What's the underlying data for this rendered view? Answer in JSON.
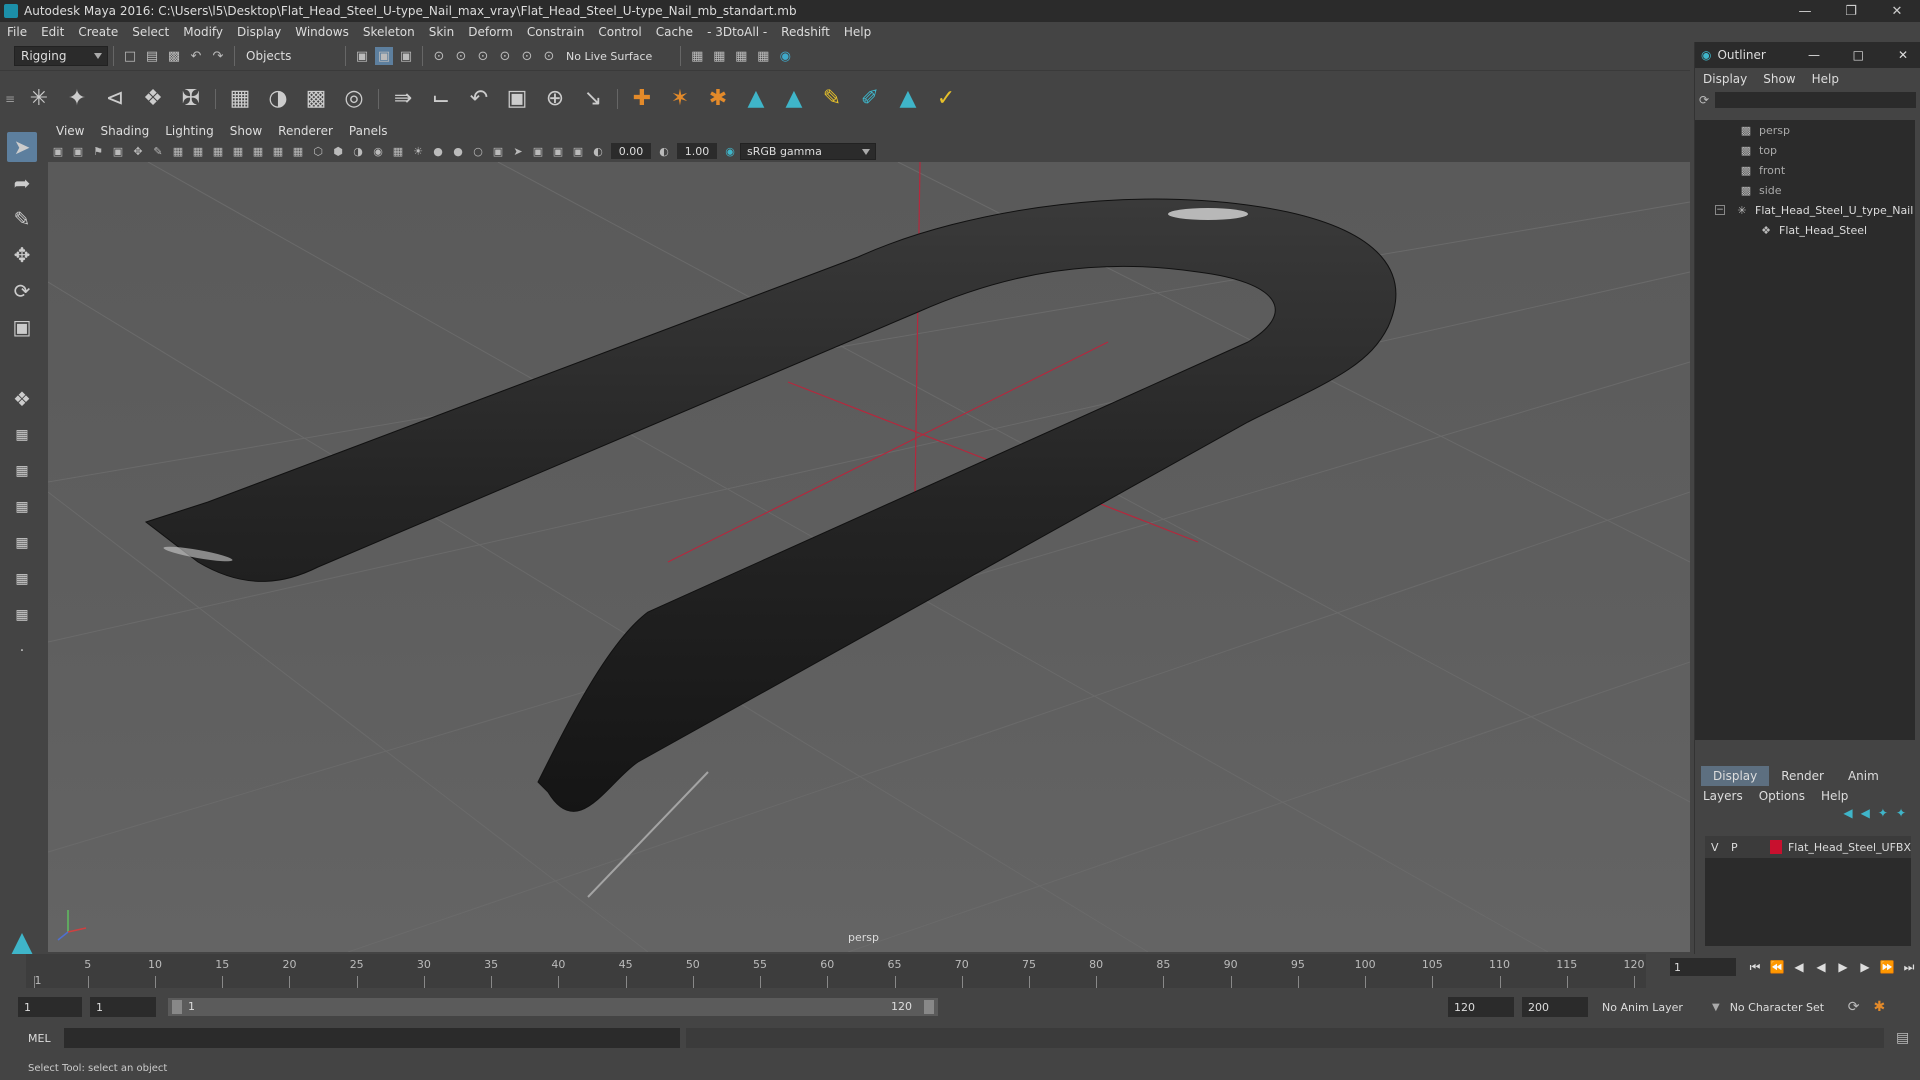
{
  "window": {
    "title": "Autodesk Maya 2016: C:\\Users\\l5\\Desktop\\Flat_Head_Steel_U-type_Nail_max_vray\\Flat_Head_Steel_U-type_Nail_mb_standart.mb"
  },
  "menubar": [
    "File",
    "Edit",
    "Create",
    "Select",
    "Modify",
    "Display",
    "Windows",
    "Skeleton",
    "Skin",
    "Deform",
    "Constrain",
    "Control",
    "Cache",
    "- 3DtoAll -",
    "Redshift",
    "Help"
  ],
  "toolbar": {
    "mode": "Rigging",
    "selection_mask": "Objects",
    "live_surface": "No Live Surface"
  },
  "panel_menu": [
    "View",
    "Shading",
    "Lighting",
    "Show",
    "Renderer",
    "Panels"
  ],
  "viewport_toolbar": {
    "exposure": "0.00",
    "gamma": "1.00",
    "colorspace": "sRGB gamma"
  },
  "viewport": {
    "camera": "persp"
  },
  "outliner": {
    "title": "Outliner",
    "menu": [
      "Display",
      "Show",
      "Help"
    ],
    "items": [
      {
        "label": "persp"
      },
      {
        "label": "top"
      },
      {
        "label": "front"
      },
      {
        "label": "side"
      },
      {
        "label": "Flat_Head_Steel_U_type_Nail"
      },
      {
        "label": "Flat_Head_Steel"
      }
    ]
  },
  "layers": {
    "tabs": [
      "Display",
      "Render",
      "Anim"
    ],
    "menu": [
      "Layers",
      "Options",
      "Help"
    ],
    "row": {
      "v": "V",
      "p": "P",
      "name": "Flat_Head_Steel_UFBX",
      "color": "#c8102e"
    }
  },
  "timeline": {
    "ticks": [
      "5",
      "10",
      "15",
      "20",
      "25",
      "30",
      "35",
      "40",
      "45",
      "50",
      "55",
      "60",
      "65",
      "70",
      "75",
      "80",
      "85",
      "90",
      "95",
      "100",
      "105",
      "110",
      "115",
      "120"
    ],
    "current_start": "1",
    "current_frame": "1"
  },
  "range": {
    "start": "1",
    "playback_start": "1",
    "slider_start": "1",
    "slider_end": "120",
    "playback_end": "120",
    "end": "200",
    "anim_layer": "No Anim Layer",
    "character_set": "No Character Set"
  },
  "cmdline": {
    "lang": "MEL"
  },
  "status": {
    "help": "Select Tool: select an object"
  }
}
